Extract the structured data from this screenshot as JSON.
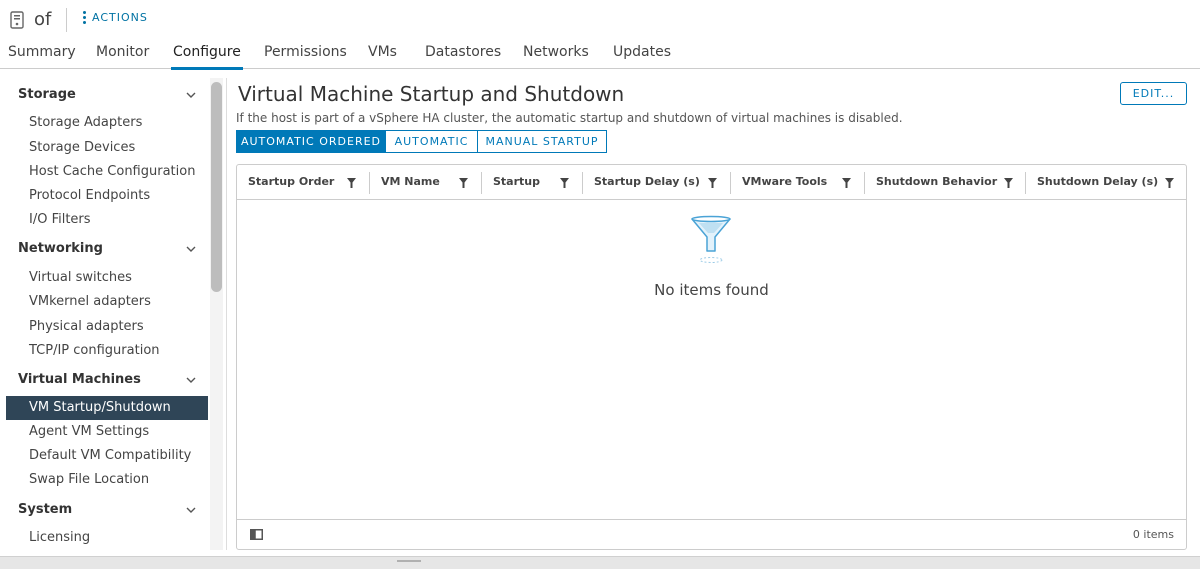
{
  "header": {
    "host_name": "of",
    "actions_label": "ACTIONS"
  },
  "tabs": [
    {
      "label": "Summary"
    },
    {
      "label": "Monitor"
    },
    {
      "label": "Configure",
      "active": true
    },
    {
      "label": "Permissions"
    },
    {
      "label": "VMs"
    },
    {
      "label": "Datastores"
    },
    {
      "label": "Networks"
    },
    {
      "label": "Updates"
    }
  ],
  "sidebar": {
    "sections": [
      {
        "title": "Storage",
        "items": [
          "Storage Adapters",
          "Storage Devices",
          "Host Cache Configuration",
          "Protocol Endpoints",
          "I/O Filters"
        ]
      },
      {
        "title": "Networking",
        "items": [
          "Virtual switches",
          "VMkernel adapters",
          "Physical adapters",
          "TCP/IP configuration"
        ]
      },
      {
        "title": "Virtual Machines",
        "items": [
          "VM Startup/Shutdown",
          "Agent VM Settings",
          "Default VM Compatibility",
          "Swap File Location"
        ]
      },
      {
        "title": "System",
        "items": [
          "Licensing"
        ]
      }
    ],
    "selected_item": "VM Startup/Shutdown"
  },
  "main": {
    "title": "Virtual Machine Startup and Shutdown",
    "edit_label": "EDIT...",
    "description": "If the host is part of a vSphere HA cluster, the automatic startup and shutdown of virtual machines is disabled.",
    "modes": [
      {
        "label": "AUTOMATIC ORDERED",
        "selected": true
      },
      {
        "label": "AUTOMATIC",
        "selected": false
      },
      {
        "label": "MANUAL STARTUP",
        "selected": false
      }
    ],
    "columns": [
      "Startup Order",
      "VM Name",
      "Startup",
      "Startup Delay (s)",
      "VMware Tools",
      "Shutdown Behavior",
      "Shutdown Delay (s)"
    ],
    "empty_text": "No items found",
    "item_count": "0 items"
  },
  "colors": {
    "accent": "#0079b8",
    "selected_bg": "#2f4557"
  }
}
